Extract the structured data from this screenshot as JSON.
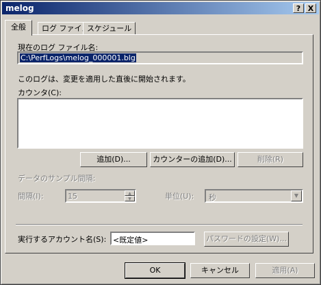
{
  "window": {
    "title": "melog",
    "help_glyph": "?",
    "close_glyph": "X"
  },
  "tabs": [
    {
      "label": "全般"
    },
    {
      "label": "ログ ファイル"
    },
    {
      "label": "スケジュール"
    }
  ],
  "general": {
    "current_log_label": "現在のログ ファイル名:",
    "current_log_value": "C:\\PerfLogs\\melog_000001.blg",
    "info_text": "このログは、変更を適用した直後に開始されます。",
    "counters_label": "カウンタ(C):",
    "counters": [],
    "add_button": "追加(D)...",
    "add_counter_button": "カウンターの追加(D)...",
    "remove_button": "削除(R)",
    "sample_group_label": "データのサンプル間隔:",
    "interval_label": "間隔(I):",
    "interval_value": "15",
    "units_label": "単位(U):",
    "units_value": "秒",
    "run_as_label": "実行するアカウント名(S):",
    "run_as_value": "<既定値>",
    "set_password_button": "パスワードの設定(W)..."
  },
  "footer": {
    "ok": "OK",
    "cancel": "キャンセル",
    "apply": "適用(A)"
  }
}
